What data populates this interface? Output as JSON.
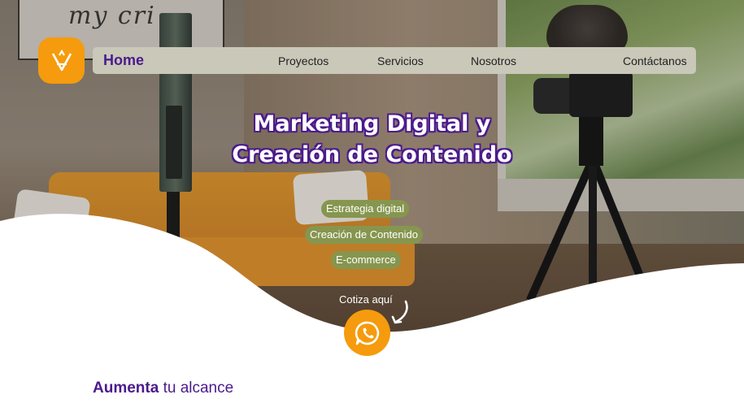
{
  "hero": {
    "whiteboard_text": "my cri",
    "title_line1": "Marketing Digital y",
    "title_line2": "Creación de Contenido",
    "services": [
      "Estrategia digital",
      "Creación de Contenido",
      "E-commerce"
    ],
    "cta_text": "Cotiza aquí"
  },
  "nav": {
    "home_label": "Home",
    "links": [
      "Proyectos",
      "Servicios",
      "Nosotros",
      "Contáctanos"
    ]
  },
  "icons": {
    "logo": "va-logo-icon",
    "cta": "whatsapp-icon",
    "arrow": "curved-arrow-icon"
  },
  "section": {
    "heading_strong": "Aumenta",
    "heading_rest": "tu alcance"
  },
  "colors": {
    "brand_purple": "#4b1a8c",
    "brand_orange": "#f59b0d",
    "pill_green": "#86964f",
    "navbar_bg": "#c9c8b9"
  }
}
